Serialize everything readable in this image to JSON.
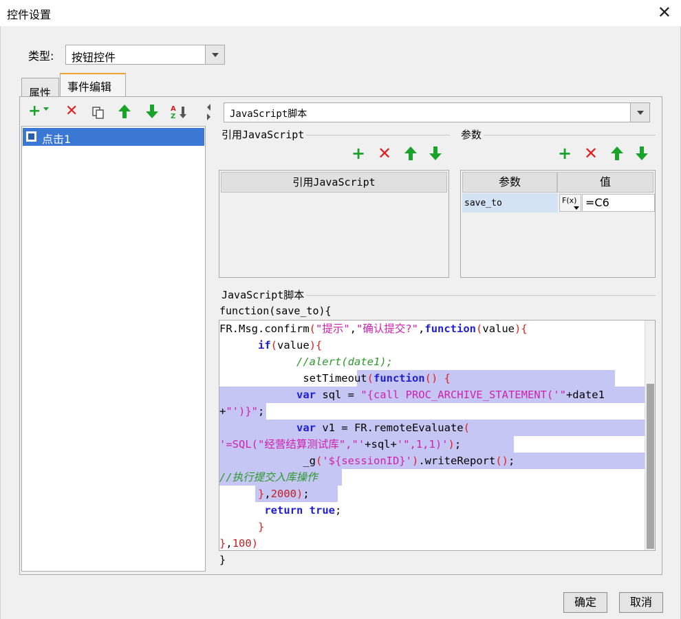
{
  "window": {
    "title": "控件设置"
  },
  "type_field": {
    "label": "类型:",
    "value": "按钮控件"
  },
  "tabs": [
    {
      "label": "属性"
    },
    {
      "label": "事件编辑"
    }
  ],
  "events": {
    "items": [
      {
        "label": "点击1"
      }
    ]
  },
  "script_type": {
    "value": "JavaScript脚本"
  },
  "ref_section": {
    "title": "引用JavaScript",
    "column": "引用JavaScript"
  },
  "param_section": {
    "title": "参数",
    "columns": [
      "参数",
      "值"
    ],
    "rows": [
      {
        "name": "save_to",
        "fx": "F(x)",
        "value": "=C6"
      }
    ]
  },
  "script_section": {
    "title": "JavaScript脚本",
    "header": "function(save_to){",
    "footer": "}"
  },
  "code_lines": [
    "FR.Msg.confirm(\"提示\",\"确认提交?\",function(value){",
    "      if(value){",
    "            //alert(date1);",
    "             setTimeout(function() {",
    "            var sql = \"{call PROC_ARCHIVE_STATEMENT('\"+date1",
    "+\"')}\";",
    "            var v1 = FR.remoteEvaluate(",
    "'=SQL(\"经营结算测试库\",\"'+sql+'\",1,1)');",
    "             _g('${sessionID}').writeReport();",
    "//执行提交入库操作",
    "      },2000);",
    "       return true;",
    "      }",
    "},100)"
  ],
  "buttons": {
    "ok": "确定",
    "cancel": "取消"
  },
  "icons": {
    "add": "+",
    "delete": "✕",
    "copy": "copy-icon",
    "up": "arrow-up",
    "down": "arrow-down",
    "sort": "sort-az"
  },
  "colors": {
    "selection": "#3a78d4",
    "highlight": "#c6c6f4",
    "accent_tab": "#f0a030",
    "green": "#1aa32a",
    "red": "#e02020"
  }
}
